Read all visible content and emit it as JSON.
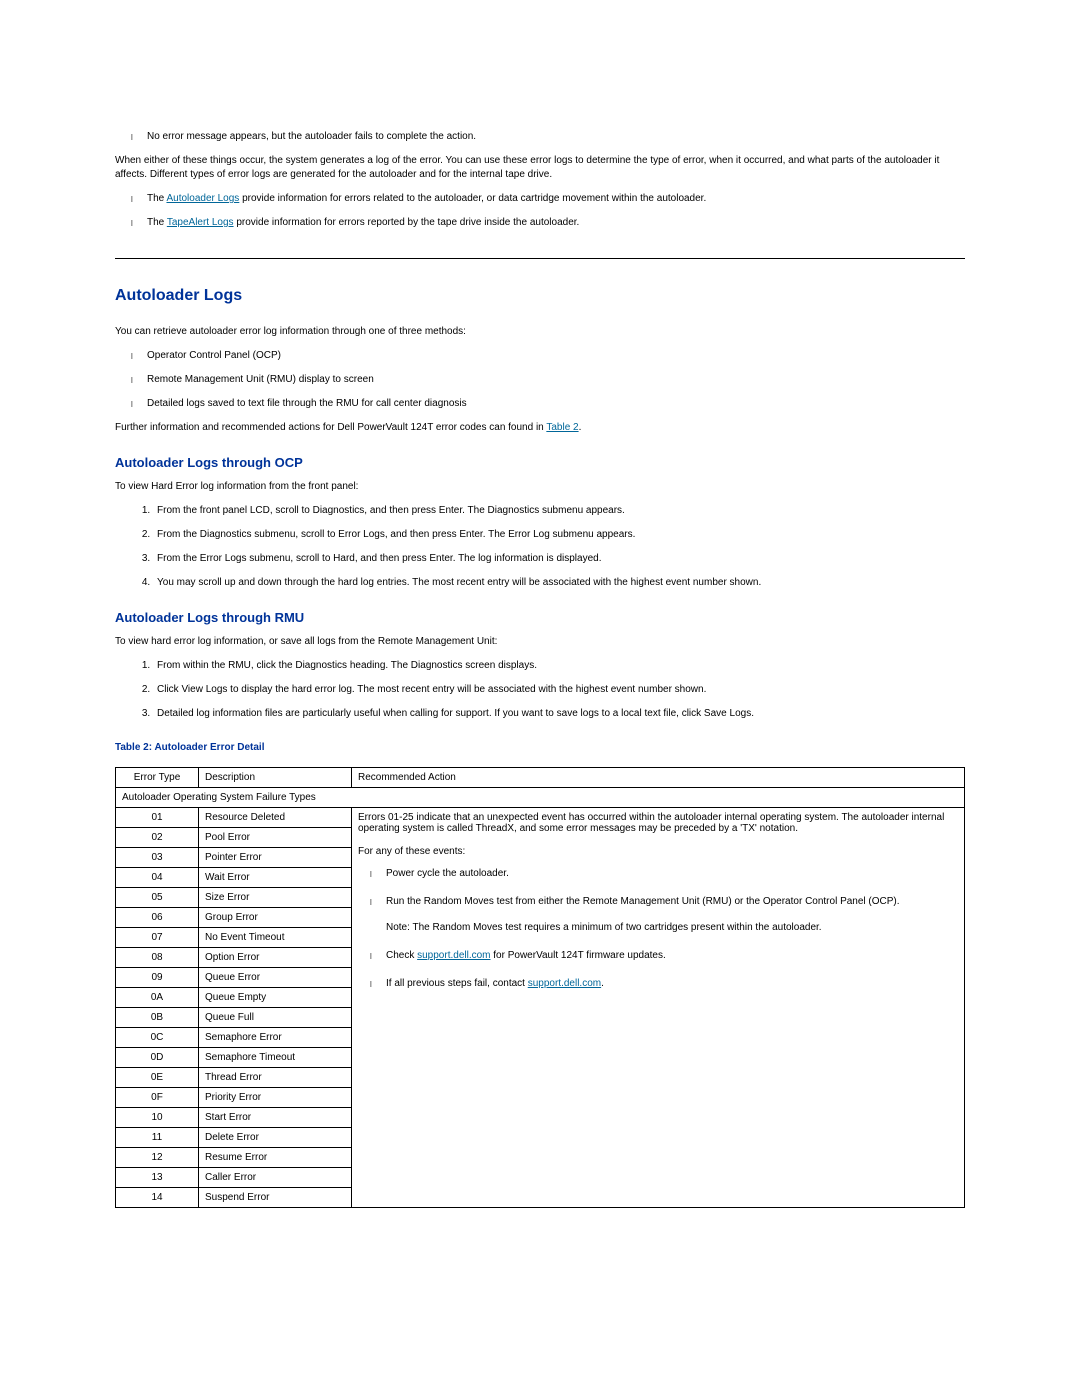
{
  "intro": {
    "bullet1": "No error message appears, but the autoloader fails to complete the action.",
    "para1": "When either of these things occur, the system generates a log of the error. You can use these error logs to determine the type of error, when it occurred, and what parts of the autoloader it affects. Different types of error logs are generated for the autoloader and for the internal tape drive.",
    "bullet2_pre": "The ",
    "bullet2_link": "Autoloader Logs",
    "bullet2_post": " provide information for errors related to the autoloader, or data cartridge movement within the autoloader.",
    "bullet3_pre": "The ",
    "bullet3_link": "TapeAlert Logs",
    "bullet3_post": " provide information for errors reported by the tape drive inside the autoloader."
  },
  "section": {
    "title": "Autoloader Logs",
    "intro": "You can retrieve autoloader error log information through one of three methods:",
    "methods": {
      "m1": "Operator Control Panel (OCP)",
      "m2": "Remote Management Unit (RMU) display to screen",
      "m3": "Detailed logs saved to text file through the RMU for call center diagnosis"
    },
    "further_pre": "Further information and recommended actions for Dell PowerVault 124T error codes can found in ",
    "further_link": "Table 2",
    "further_post": ".",
    "ocp": {
      "heading": "Autoloader Logs through OCP",
      "intro": "To view Hard Error log information from the front panel:",
      "step1": "From the front panel LCD, scroll to Diagnostics, and then press Enter. The Diagnostics submenu appears.",
      "step2": "From the Diagnostics submenu, scroll to Error Logs, and then press Enter. The Error Log submenu appears.",
      "step3": "From the Error Logs submenu, scroll to Hard, and then press Enter. The log information is displayed.",
      "step4": "You may scroll up and down through the hard log entries. The most recent entry will be associated with the highest event number shown."
    },
    "rmu": {
      "heading": "Autoloader Logs through RMU",
      "intro": "To view hard error log information, or save all logs from the Remote Management Unit:",
      "step1": "From within the RMU, click the Diagnostics heading. The Diagnostics screen displays.",
      "step2": "Click View Logs to display the hard error log. The most recent entry will be associated with the highest event number shown.",
      "step3": "Detailed log information files are particularly useful when calling for support. If you want to save logs to a local text file, click Save Logs."
    }
  },
  "table": {
    "caption": "Table 2: Autoloader Error Detail",
    "headers": {
      "col1": "Error Type",
      "col2": "Description",
      "col3": "Recommended Action"
    },
    "section_row": "Autoloader Operating System Failure Types",
    "rows": [
      {
        "code": "01",
        "desc": "Resource Deleted"
      },
      {
        "code": "02",
        "desc": "Pool Error"
      },
      {
        "code": "03",
        "desc": "Pointer Error"
      },
      {
        "code": "04",
        "desc": "Wait Error"
      },
      {
        "code": "05",
        "desc": "Size Error"
      },
      {
        "code": "06",
        "desc": "Group Error"
      },
      {
        "code": "07",
        "desc": "No Event Timeout"
      },
      {
        "code": "08",
        "desc": "Option Error"
      },
      {
        "code": "09",
        "desc": "Queue Error"
      },
      {
        "code": "0A",
        "desc": "Queue Empty"
      },
      {
        "code": "0B",
        "desc": "Queue Full"
      },
      {
        "code": "0C",
        "desc": "Semaphore Error"
      },
      {
        "code": "0D",
        "desc": "Semaphore Timeout"
      },
      {
        "code": "0E",
        "desc": "Thread Error"
      },
      {
        "code": "0F",
        "desc": "Priority Error"
      },
      {
        "code": "10",
        "desc": "Start Error"
      },
      {
        "code": "11",
        "desc": "Delete Error"
      },
      {
        "code": "12",
        "desc": "Resume Error"
      },
      {
        "code": "13",
        "desc": "Caller Error"
      },
      {
        "code": "14",
        "desc": "Suspend Error"
      }
    ],
    "action": {
      "intro": "Errors 01-25 indicate that an unexpected event has occurred within the autoloader internal operating system. The autoloader internal operating system is called ThreadX, and some error messages may be preceded by a 'TX' notation.",
      "for_any": "For any of these events:",
      "a1": "Power cycle the autoloader.",
      "a2": "Run the Random Moves test from either the Remote Management Unit (RMU) or the Operator Control Panel (OCP).",
      "a2_note": "Note: The Random Moves test requires a minimum of two cartridges present within the autoloader.",
      "a3_pre": "Check ",
      "a3_link": "support.dell.com",
      "a3_post": " for PowerVault 124T firmware updates.",
      "a4_pre": "If all previous steps fail, contact ",
      "a4_link": "support.dell.com",
      "a4_post": "."
    }
  }
}
